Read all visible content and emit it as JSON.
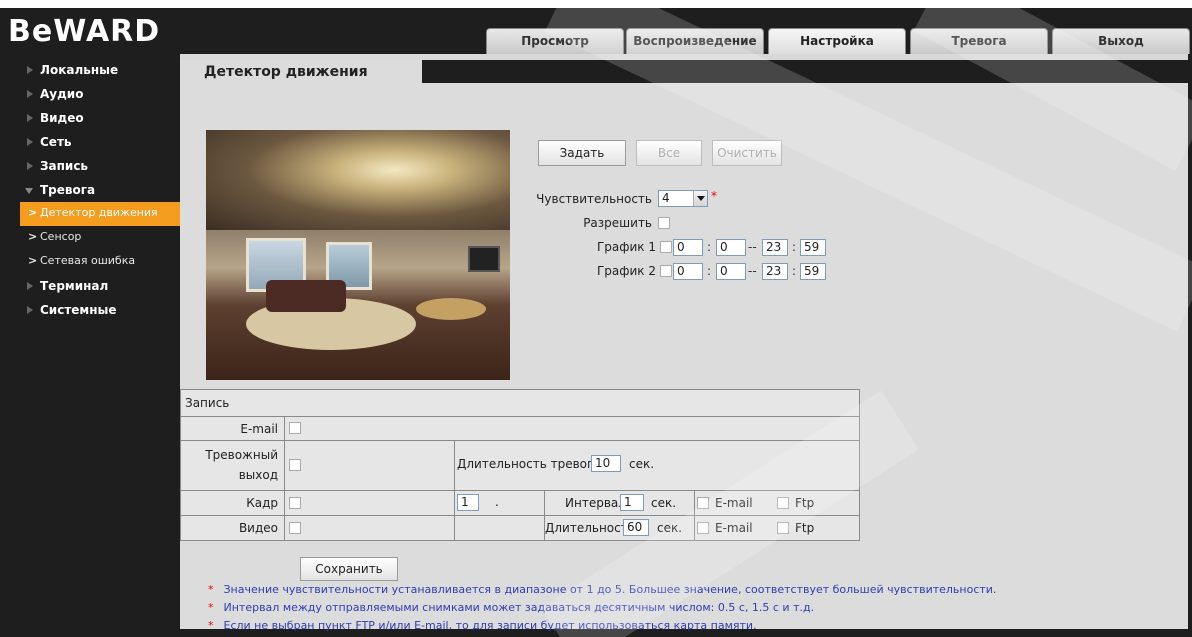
{
  "brand": {
    "logo": "BeWARD"
  },
  "top_nav": {
    "tabs": [
      {
        "label": "Просмотр"
      },
      {
        "label": "Воспроизведение"
      },
      {
        "label": "Настройка"
      },
      {
        "label": "Тревога"
      },
      {
        "label": "Выход"
      }
    ],
    "active_tab": "Настройка"
  },
  "sidebar": {
    "items": [
      {
        "label": "Локальные"
      },
      {
        "label": "Аудио"
      },
      {
        "label": "Видео"
      },
      {
        "label": "Сеть"
      },
      {
        "label": "Запись"
      },
      {
        "label": "Тревога"
      },
      {
        "label": "Терминал"
      },
      {
        "label": "Системные"
      }
    ],
    "alarm_sub": [
      {
        "label": "Детектор движения"
      },
      {
        "label": "Сенсор"
      },
      {
        "label": "Сетевая ошибка"
      }
    ],
    "active_sub": "Детектор движения"
  },
  "page": {
    "title": "Детектор движения"
  },
  "area_buttons": {
    "set": "Задать",
    "all": "Все",
    "clear": "Очистить"
  },
  "settings": {
    "sensitivity_label": "Чувствительность",
    "sensitivity_value": "4",
    "required_mark": "*",
    "enable_label": "Разрешить",
    "schedule1": {
      "label": "График 1",
      "start_h": "0",
      "start_m": "0",
      "end_h": "23",
      "end_m": "59"
    },
    "schedule2": {
      "label": "График 2",
      "start_h": "0",
      "start_m": "0",
      "end_h": "23",
      "end_m": "59"
    },
    "time_sep": ":",
    "range_sep": "--"
  },
  "record": {
    "header": "Запись",
    "email_label": "E-mail",
    "alarm_out_label_1": "Тревожный",
    "alarm_out_label_2": "выход",
    "alarm_duration_label": "Длительность тревоги",
    "alarm_duration_value": "10",
    "sec": "сек.",
    "frame_label": "Кадр",
    "frame_count": "1",
    "frame_dot": ".",
    "interval_label": "Интервал",
    "interval_value": "1",
    "video_label": "Видео",
    "duration_label": "Длительность",
    "duration_value": "60",
    "opt_email": "E-mail",
    "opt_ftp": "Ftp"
  },
  "save_button": "Сохранить",
  "notes": {
    "star": "*",
    "lines": [
      "Значение чувствительности устанавливается в диапазоне от 1 до 5. Большее значение, соответствует большей чувствительности.",
      "Интервал между отправляемыми снимками может задаваться десятичным числом: 0.5 с, 1.5 с и т.д.",
      "Если не выбран пункт FTP и/или E-mail, то для записи будет использоваться карта памяти."
    ]
  },
  "colors": {
    "accent": "#f39c1e",
    "note_text": "#2a3fb0",
    "background": "#1e1e1e",
    "panel": "#dcdcdc"
  }
}
